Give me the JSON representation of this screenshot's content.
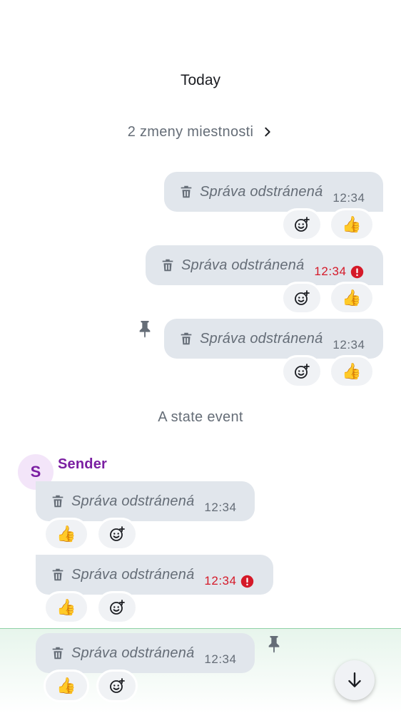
{
  "timeline": {
    "date_separator": "Today",
    "room_changes": "2 zmeny miestnosti",
    "state_event": "A state event",
    "sender": {
      "name": "Sender",
      "initial": "S"
    }
  },
  "messages": [
    {
      "text": "Správa odstránená",
      "time": "12:34",
      "error": false,
      "pinned": false,
      "reaction": "👍"
    },
    {
      "text": "Správa odstránená",
      "time": "12:34",
      "error": true,
      "pinned": false,
      "reaction": "👍"
    },
    {
      "text": "Správa odstránená",
      "time": "12:34",
      "error": false,
      "pinned": true,
      "reaction": "👍"
    },
    {
      "text": "Správa odstránená",
      "time": "12:34",
      "error": false,
      "pinned": false,
      "reaction": "👍"
    },
    {
      "text": "Správa odstránená",
      "time": "12:34",
      "error": true,
      "pinned": false,
      "reaction": "👍"
    },
    {
      "text": "Správa odstránená",
      "time": "12:34",
      "error": false,
      "pinned": true,
      "reaction": "👍",
      "highlighted": true
    }
  ],
  "icons": {
    "trash": "trash-icon",
    "add_reaction": "add-reaction-icon",
    "pin": "pin-icon",
    "error": "error-icon",
    "chevron": "chevron-right-icon",
    "scroll_down": "arrow-down-icon"
  },
  "colors": {
    "bubble": "#e1e6ec",
    "reaction_bg": "#f0f2f5",
    "secondary_text": "#656d77",
    "error": "#d51928",
    "sender": "#7b1fa2",
    "avatar_bg": "#f3e5f9",
    "highlight": "#e7f5ec"
  }
}
